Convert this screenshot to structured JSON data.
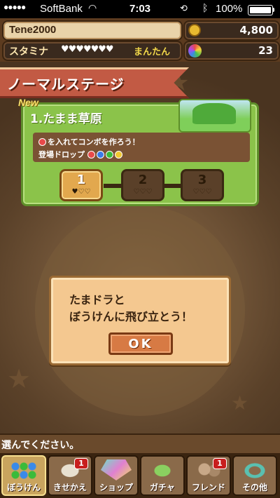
{
  "status_bar": {
    "carrier": "SoftBank",
    "time": "7:03",
    "battery": "100%"
  },
  "header": {
    "player_name": "Tene2000",
    "stamina_label": "スタミナ",
    "stamina_hearts": "♥♥♥♥♥♥♥",
    "stamina_status": "まんたん",
    "coins": "4,800",
    "gems": "23"
  },
  "stage_select": {
    "banner": "ノーマルステージ",
    "new_badge": "New",
    "stage_title": "1.たまま草原",
    "description_line1": "を入れてコンボを作ろう！",
    "description_line2": "登場ドロップ",
    "drop_colors": [
      "#e84a4a",
      "#3a7ae8",
      "#3abb3a",
      "#f0c830"
    ],
    "levels": [
      {
        "number": "1",
        "hearts": "♥♡♡",
        "active": true
      },
      {
        "number": "2",
        "hearts": "♡♡♡",
        "active": false
      },
      {
        "number": "3",
        "hearts": "♡♡♡",
        "active": false
      }
    ]
  },
  "dialog": {
    "line1": "たまドラと",
    "line2": "ぼうけんに飛び立とう！",
    "ok_label": "OK"
  },
  "message": "選んでください。",
  "bottom_nav": [
    {
      "label": "ぼうけん",
      "icon": "adventure-orbs-icon",
      "badge": "",
      "active": true
    },
    {
      "label": "きせかえ",
      "icon": "dragon-outfit-icon",
      "badge": "1",
      "active": false
    },
    {
      "label": "ショップ",
      "icon": "crystal-shop-icon",
      "badge": "",
      "active": false
    },
    {
      "label": "ガチャ",
      "icon": "egg-gacha-icon",
      "badge": "",
      "active": false
    },
    {
      "label": "フレンド",
      "icon": "friend-icon",
      "badge": "1",
      "active": false
    },
    {
      "label": "その他",
      "icon": "other-ring-icon",
      "badge": "",
      "active": false
    }
  ]
}
